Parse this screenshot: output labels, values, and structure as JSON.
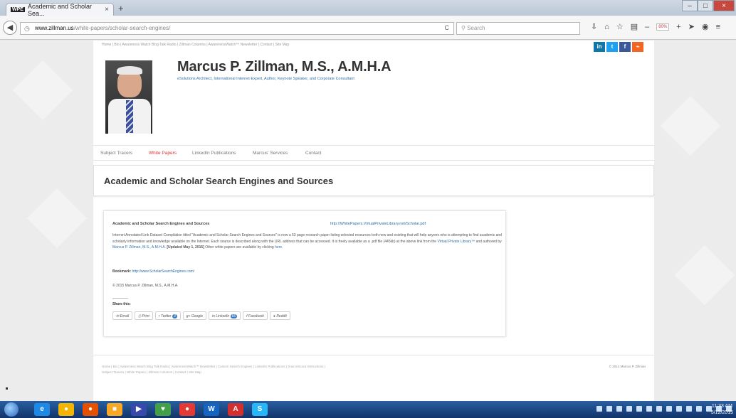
{
  "browser": {
    "tab_title": "Academic and Scholar Sea...",
    "tab_favicon": "WPE",
    "tab_close": "×",
    "new_tab": "+",
    "url_host": "www.zillman.us",
    "url_path": "/white-papers/scholar-search-engines/",
    "reload": "C",
    "search_placeholder": "Search",
    "zoom": "80%"
  },
  "site": {
    "top_nav": "Home  |  Bio  |  Awareness Watch Blog Talk Radio  |  Zillman Columns  |  AwarenessWatch™ Newsletter  |  Contact  |  Site Map",
    "social": [
      "in",
      "t",
      "f",
      "rss"
    ],
    "social_colors": [
      "#0e76a8",
      "#1da1f2",
      "#3b5998",
      "#f26522"
    ],
    "name": "Marcus P. Zillman, M.S., A.M.H.A",
    "tagline": "eSolutions Architect, International Internet Expert, Author, Keynote Speaker, and Corporate Consultant",
    "nav": [
      "Subject Tracers",
      "White Papers",
      "LinkedIn Publications",
      "Marcus' Services",
      "Contact"
    ],
    "active_nav": "White Papers",
    "accent": "#dd3333",
    "link_color": "#2d6fa8"
  },
  "main": {
    "heading": "Academic and Scholar Search Engines and Sources",
    "card_title": "Academic and Scholar Search Engines and Sources",
    "card_link": "http://WhitePapers.VirtualPrivateLibrary.net/Scholar.pdf",
    "body_text_1": "Internet Annotated Link Dataset Compilation titled \"Academic and Scholar Search Engines and Sources\" is now a 53 page research paper listing selected resources both new and existing that will help anyone who is attempting to find academic and scholarly information and knowledge available on the Internet. Each source is described along with the URL address that can be accessed. It is freely available as a .pdf file (445kb) at the above link from the ",
    "body_link_1": "Virtual Private Library™",
    "body_text_2": " and authored by ",
    "body_link_2": "Marcus P. Zillman, M.S., A.M.H.A.",
    "body_updated": " [Updated May 1, 2015]",
    "body_text_3": " Other white papers are available by clicking ",
    "body_link_3": "here",
    "body_text_4": ".",
    "bookmark_label": "Bookmark:",
    "bookmark_link": "http://www.ScholarSearchEngines.com/",
    "copyright": "© 2015 Marcus P. Zillman, M.S., A.M.H.A.",
    "share_label": "Share this:",
    "share_buttons": [
      {
        "icon": "✉",
        "label": "Email"
      },
      {
        "icon": "⎙",
        "label": "Print"
      },
      {
        "icon": "•",
        "label": "Twitter",
        "count": "3"
      },
      {
        "icon": "g+",
        "label": "Google"
      },
      {
        "icon": "in",
        "label": "LinkedIn",
        "count": "66"
      },
      {
        "icon": "f",
        "label": "Facebook"
      },
      {
        "icon": "●",
        "label": "Reddit"
      }
    ]
  },
  "footer": {
    "line1": "Home  |  Bio  |  Awareness Watch Blog Talk Radio  |  AwarenessWatch™ Newsletter  |  Custom Search Engines  |  LinkedIn Publications  |  SourceScout Instructions  |",
    "line2": "Subject Tracers  |  White Papers  |  Zillman Columns  |  Contact  |  Site Map",
    "copyright": "© 2014 Marcus P. Zillman"
  },
  "taskbar": {
    "apps": [
      "e",
      "●",
      "●",
      "■",
      "▶",
      "♥",
      "●",
      "W",
      "A",
      "S"
    ],
    "app_colors": [
      "#1e88e5",
      "#f4b400",
      "#e65100",
      "#f9a825",
      "#3949ab",
      "#43a047",
      "#e53935",
      "#1565c0",
      "#d32f2f",
      "#29b6f6"
    ],
    "time": "11:33 AM",
    "date": "5/12/2015"
  }
}
